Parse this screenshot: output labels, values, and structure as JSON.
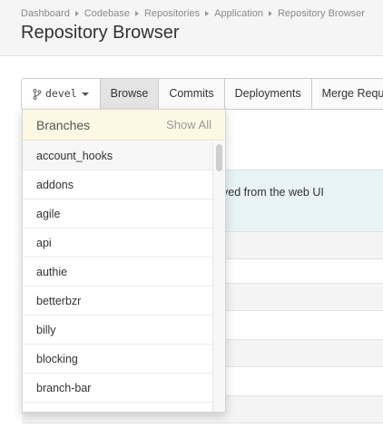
{
  "breadcrumb": [
    "Dashboard",
    "Codebase",
    "Repositories",
    "Application",
    "Repository Browser"
  ],
  "page_title": "Repository Browser",
  "toolbar": {
    "branch_label": "devel",
    "browse_label": "Browse",
    "commits_label": "Commits",
    "deployments_label": "Deployments",
    "merge_requests_label": "Merge Requ"
  },
  "info_text": "ved from the web UI",
  "dropdown": {
    "title": "Branches",
    "show_all_label": "Show All",
    "items": [
      "account_hooks",
      "addons",
      "agile",
      "api",
      "authie",
      "betterbzr",
      "billy",
      "blocking",
      "branch-bar"
    ]
  },
  "colors": {
    "dropdown_header_bg": "#fcf8e3",
    "info_bar_bg": "#e7f3f7",
    "active_tab_bg": "#e4e4e4"
  }
}
